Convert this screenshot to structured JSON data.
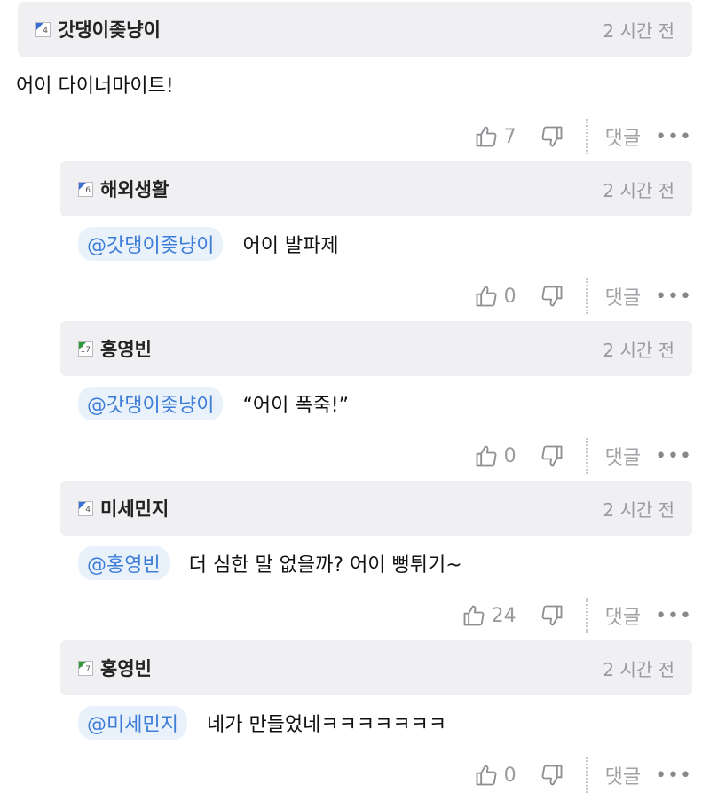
{
  "comments": [
    {
      "author": "갓댕이좆냥이",
      "level": "4",
      "level_color": "#3b6fd4",
      "time": "2 시간 전",
      "mention": "",
      "text": "어이 다이너마이트!",
      "likes": "7"
    },
    {
      "author": "해외생활",
      "level": "6",
      "level_color": "#3b6fd4",
      "time": "2 시간 전",
      "mention": "@갓댕이좆냥이",
      "text": "어이 발파제",
      "likes": "0"
    },
    {
      "author": "홍영빈",
      "level": "17",
      "level_color": "#2e9a3c",
      "time": "2 시간 전",
      "mention": "@갓댕이좆냥이",
      "text": "“어이 폭죽!”",
      "likes": "0"
    },
    {
      "author": "미세민지",
      "level": "4",
      "level_color": "#3b6fd4",
      "time": "2 시간 전",
      "mention": "@홍영빈",
      "text": "더 심한 말 없을까? 어이 뻥튀기~",
      "likes": "24"
    },
    {
      "author": "홍영빈",
      "level": "17",
      "level_color": "#2e9a3c",
      "time": "2 시간 전",
      "mention": "@미세민지",
      "text": "네가 만들었네ㅋㅋㅋㅋㅋㅋㅋ",
      "likes": "0"
    }
  ],
  "labels": {
    "reply": "댓글",
    "more": "•••"
  },
  "icons": {
    "like": "thumbs-up-icon",
    "dislike": "thumbs-down-icon"
  },
  "colors": {
    "mention_bg": "#e9f2fb",
    "mention_text": "#3d7dd8",
    "header_bg": "#f0f0f2"
  }
}
